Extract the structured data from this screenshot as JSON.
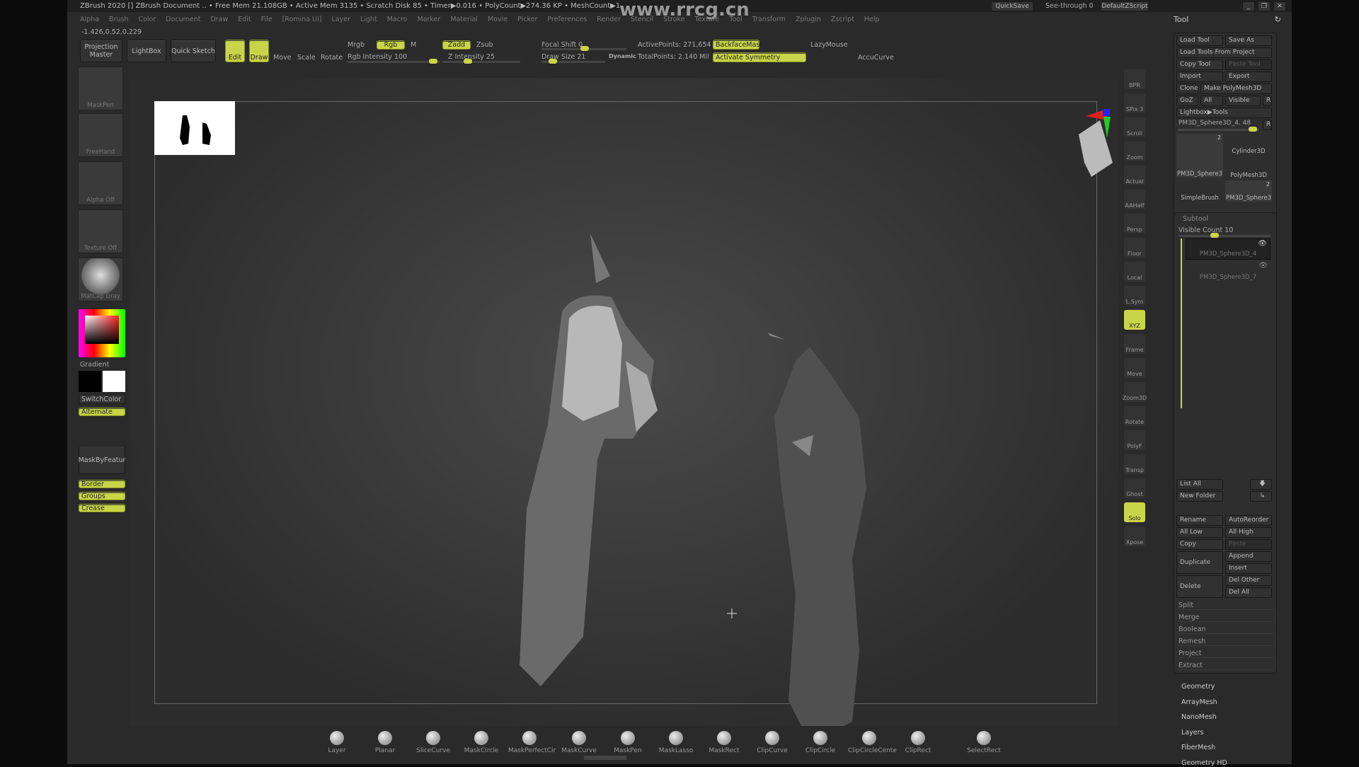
{
  "titlebar": {
    "text": "ZBrush 2020 [] ZBrush Document  .. • Free Mem 21.108GB • Active Mem 3135 • Scratch Disk 85 • Timer▶0.016 • PolyCount▶274.36 KP • MeshCount▶1",
    "watermark": "www.rrcg.cn"
  },
  "window_buttons": {
    "quicksave": "QuickSave",
    "see_through": "See-through  0",
    "default_zscript": "DefaultZScript"
  },
  "menu": [
    "Alpha",
    "Brush",
    "Color",
    "Document",
    "Draw",
    "Edit",
    "File",
    "[Romina UI]",
    "Layer",
    "Light",
    "Macro",
    "Marker",
    "Material",
    "Movie",
    "Picker",
    "Preferences",
    "Render",
    "Stencil",
    "Stroke",
    "Texture",
    "Tool",
    "Transform",
    "Zplugin",
    "Zscript",
    "Help"
  ],
  "coords": "-1.426,0.52,0.229",
  "toolbar": {
    "projection_master": "Projection Master",
    "lightbox": "LightBox",
    "quick_sketch": "Quick Sketch",
    "edit": "Edit",
    "draw": "Draw",
    "move": "Move",
    "scale": "Scale",
    "rotate": "Rotate",
    "mrgb": "Mrgb",
    "rgb": "Rgb",
    "m": "M",
    "rgb_intensity": "Rgb Intensity 100",
    "rgb_intensity_value": 100,
    "zadd": "Zadd",
    "zsub": "Zsub",
    "z_intensity": "Z Intensity 25",
    "z_intensity_value": 25,
    "focal_shift": "Focal Shift 0",
    "draw_size": "Draw Size 21",
    "dynamic": "Dynamic",
    "active_points": "ActivePoints: 271,654",
    "total_points": "TotalPoints: 2.140 Mil",
    "backface_mask": "BackfaceMask",
    "activate_symmetry": "Activate Symmetry",
    "lazymouse": "LazyMouse",
    "accucurve": "AccuCurve"
  },
  "left_shelf": {
    "brush": "MaskPen",
    "stroke": "FreeHand",
    "alpha": "Alpha Off",
    "texture": "Texture Off",
    "material": "MatCap Gray",
    "gradient": "Gradient",
    "switch_color": "SwitchColor",
    "alternate": "Alternate",
    "mask_by_feature": "MaskByFeatur",
    "border": "Border",
    "groups": "Groups",
    "crease": "Crease"
  },
  "right_shelf": [
    "BPR",
    "SPix 3",
    "Scroll",
    "Zoom",
    "Actual",
    "AAHalf",
    "Persp",
    "Floor",
    "Local",
    "L.Sym",
    "XYZ",
    "Frame",
    "Move",
    "Zoom3D",
    "Rotate",
    "PolyF",
    "Transp",
    "Ghost",
    "Solo",
    "Xpose"
  ],
  "tool_panel": {
    "title": "Tool",
    "load_tool": "Load Tool",
    "save_as": "Save As",
    "load_from_project": "Load Tools From Project",
    "copy_tool": "Copy Tool",
    "paste_tool": "Paste Tool",
    "import": "Import",
    "export": "Export",
    "clone": "Clone",
    "make_polymesh": "Make PolyMesh3D",
    "goz": "GoZ",
    "all": "All",
    "visible": "Visible",
    "r": "R",
    "lightbox_tools": "Lightbox▶Tools",
    "current_tool": "PM3D_Sphere3D_4. 48",
    "thumbs": [
      {
        "name": "PM3D_Sphere3",
        "count": "2"
      },
      {
        "name": "Cylinder3D"
      },
      {
        "name": "PolyMesh3D"
      },
      {
        "name": "SimpleBrush"
      },
      {
        "name": "PM3D_Sphere3",
        "count": "2"
      }
    ]
  },
  "subtool": {
    "title": "Subtool",
    "visible_count": "Visible Count 10",
    "items": [
      "PM3D_Sphere3D_4",
      "PM3D_Sphere3D_7"
    ],
    "list_all": "List All",
    "new_folder": "New Folder",
    "rename": "Rename",
    "autoreorder": "AutoReorder",
    "all_low": "All Low",
    "all_high": "All High",
    "copy": "Copy",
    "paste": "Paste",
    "duplicate": "Duplicate",
    "append": "Append",
    "insert": "Insert",
    "delete": "Delete",
    "del_other": "Del Other",
    "del_all": "Del All",
    "actions": [
      "Split",
      "Merge",
      "Boolean",
      "Remesh",
      "Project",
      "Extract"
    ]
  },
  "tool_sections": [
    "Geometry",
    "ArrayMesh",
    "NanoMesh",
    "Layers",
    "FiberMesh",
    "Geometry HD"
  ],
  "bottom_shelf": [
    "Layer",
    "Planar",
    "SliceCurve",
    "MaskCircle",
    "MaskPerfectCir",
    "MaskCurve",
    "MaskPen",
    "MaskLasso",
    "MaskRect",
    "ClipCurve",
    "ClipCircle",
    "ClipCircleCente",
    "ClipRect",
    "SelectRect"
  ],
  "colors": {
    "accent": "#c8d548",
    "bg": "#2a2a2a"
  }
}
